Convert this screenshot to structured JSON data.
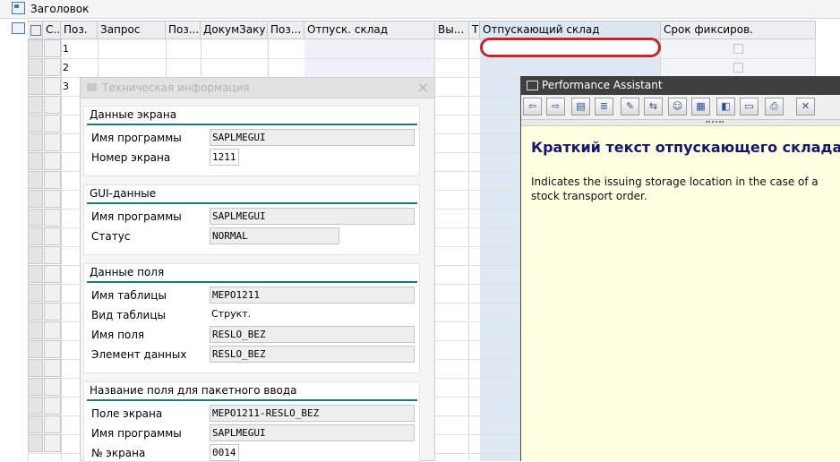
{
  "header": {
    "title": "Заголовок"
  },
  "table": {
    "columns": [
      "С..",
      "Поз.",
      "Запрос",
      "Поз...",
      "ДокумЗаку...",
      "Поз...",
      "Отпуск. склад",
      "Вы...",
      "Т",
      "Отпускающий склад",
      "Срок фиксиров."
    ],
    "rows": [
      "1",
      "2",
      "3"
    ]
  },
  "tech_dialog": {
    "title": "Техническая информация",
    "close": "×",
    "groups": [
      {
        "title": "Данные экрана",
        "fields": [
          {
            "label": "Имя программы",
            "value": "SAPLMEGUI"
          },
          {
            "label": "Номер экрана",
            "value": "1211"
          }
        ]
      },
      {
        "title": "GUI-данные",
        "fields": [
          {
            "label": "Имя программы",
            "value": "SAPLMEGUI"
          },
          {
            "label": "Статус",
            "value": "NORMAL"
          }
        ]
      },
      {
        "title": "Данные поля",
        "fields": [
          {
            "label": "Имя таблицы",
            "value": "MEPO1211"
          },
          {
            "label": "Вид таблицы",
            "value": "Структ."
          },
          {
            "label": "Имя поля",
            "value": "RESLO_BEZ"
          },
          {
            "label": "Элемент данных",
            "value": "RESLO_BEZ"
          }
        ]
      },
      {
        "title": "Название поля для пакетного ввода",
        "fields": [
          {
            "label": "Поле экрана",
            "value": "MEPO1211-RESLO_BEZ"
          },
          {
            "label": "Имя программы",
            "value": "SAPLMEGUI"
          },
          {
            "label": "№ экрана",
            "value": "0014"
          }
        ]
      }
    ]
  },
  "performance_assistant": {
    "title": "Performance Assistant",
    "heading": "Краткий текст отпускающего склада",
    "text": "Indicates the issuing storage location in the case of a stock transport order."
  },
  "colors": {
    "accent_line": "#1b7a77",
    "highlight": "#c0282e",
    "heading": "#17176a"
  }
}
